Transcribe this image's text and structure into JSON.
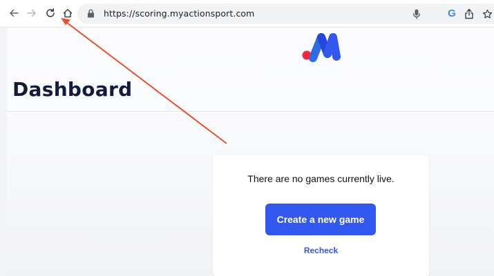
{
  "browser": {
    "url": "https://scoring.myactionsport.com",
    "icons": {
      "back": "arrow-left",
      "forward": "arrow-right",
      "reload": "reload",
      "home": "home",
      "lock": "lock",
      "mic": "microphone",
      "google": "G",
      "share": "share",
      "bookmark": "star"
    }
  },
  "page": {
    "title": "Dashboard",
    "logo": "myactionsport-logo",
    "card": {
      "message": "There are no games currently live.",
      "create_label": "Create a new game",
      "recheck_label": "Recheck"
    }
  },
  "colors": {
    "accent": "#3358f0",
    "title": "#141b3a",
    "logo_dot": "#ee2a3a",
    "annotation_arrow": "#e8502e"
  }
}
